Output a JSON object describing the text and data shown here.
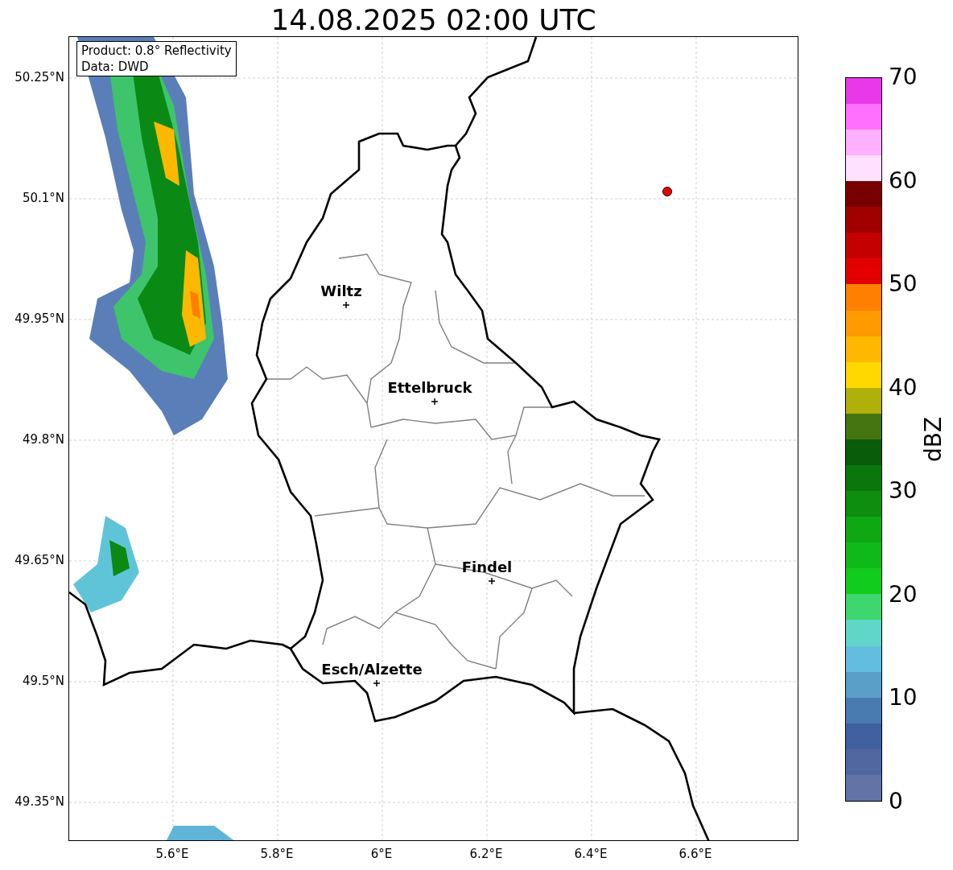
{
  "title": "14.08.2025 02:00 UTC",
  "info_box": {
    "lines": [
      "Product: 0.8° Reflectivity",
      "Data: DWD"
    ]
  },
  "map": {
    "y_ticks": [
      "50.25°N",
      "50.1°N",
      "49.95°N",
      "49.8°N",
      "49.65°N",
      "49.5°N",
      "49.35°N"
    ],
    "x_ticks": [
      "5.6°E",
      "5.8°E",
      "6°E",
      "6.2°E",
      "6.4°E",
      "6.6°E"
    ],
    "cities": [
      {
        "name": "Wiltz"
      },
      {
        "name": "Ettelbruck"
      },
      {
        "name": "Findel"
      },
      {
        "name": "Esch/Alzette"
      }
    ]
  },
  "colorbar": {
    "label": "dBZ",
    "ticks": [
      "70",
      "60",
      "50",
      "40",
      "30",
      "20",
      "10",
      "0"
    ],
    "segments": [
      {
        "color": "#6473a6"
      },
      {
        "color": "#5067a0"
      },
      {
        "color": "#40609f"
      },
      {
        "color": "#4a7bb0"
      },
      {
        "color": "#5a9fc8"
      },
      {
        "color": "#62bde0"
      },
      {
        "color": "#60d6c8"
      },
      {
        "color": "#3ed66e"
      },
      {
        "color": "#11cc1c"
      },
      {
        "color": "#10b91a"
      },
      {
        "color": "#0fa813"
      },
      {
        "color": "#0d8e0f"
      },
      {
        "color": "#0a760c"
      },
      {
        "color": "#085c0a"
      },
      {
        "color": "#447510"
      },
      {
        "color": "#b0b00a"
      },
      {
        "color": "#ffd800"
      },
      {
        "color": "#ffb800"
      },
      {
        "color": "#ff9a00"
      },
      {
        "color": "#ff7f00"
      },
      {
        "color": "#e40000"
      },
      {
        "color": "#c40000"
      },
      {
        "color": "#a00000"
      },
      {
        "color": "#780000"
      },
      {
        "color": "#ffe0ff"
      },
      {
        "color": "#ffb0ff"
      },
      {
        "color": "#ff70ff"
      },
      {
        "color": "#e838e8"
      }
    ]
  }
}
